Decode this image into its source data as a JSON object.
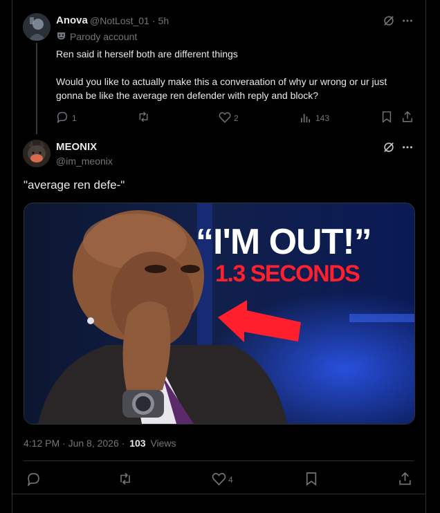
{
  "reply": {
    "display_name": "Anova",
    "handle": "@NotLost_01",
    "time": "· 5h",
    "badge_label": "Parody account",
    "text_line1": "Ren said it herself both are different things",
    "text_line2": "Would you like to actually make this a converaation of why ur wrong or ur just",
    "text_line3": "gonna be like the average ren defender with reply and block?",
    "replies": "1",
    "likes": "2",
    "views": "143"
  },
  "main": {
    "display_name": "MEONIX",
    "handle": "@im_meonix",
    "text": "\"average ren defe-\"",
    "media": {
      "headline": "“I'M OUT!”",
      "subline": "1.3 SECONDS"
    },
    "timestamp": "4:12 PM · Jun 8, 2026 ·",
    "views_count": "103",
    "views_label": "Views",
    "likes": "4"
  },
  "colors": {
    "background": "#000000",
    "text": "#e7e9ea",
    "muted": "#71767b",
    "border": "#2f3336",
    "accent_red": "#ff1f2d"
  }
}
